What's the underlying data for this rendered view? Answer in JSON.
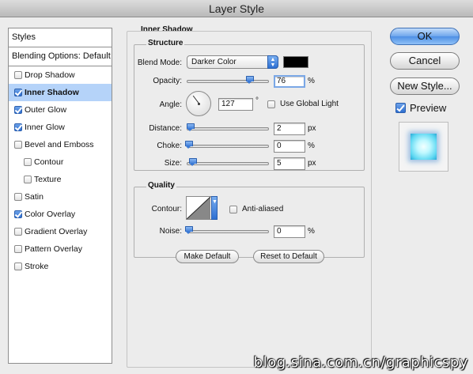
{
  "window": {
    "title": "Layer Style"
  },
  "styles_list": {
    "header": "Styles",
    "blending_options": "Blending Options: Default",
    "items": [
      {
        "label": "Drop Shadow",
        "checked": false,
        "sub": false,
        "selected": false
      },
      {
        "label": "Inner Shadow",
        "checked": true,
        "sub": false,
        "selected": true
      },
      {
        "label": "Outer Glow",
        "checked": true,
        "sub": false,
        "selected": false
      },
      {
        "label": "Inner Glow",
        "checked": true,
        "sub": false,
        "selected": false
      },
      {
        "label": "Bevel and Emboss",
        "checked": false,
        "sub": false,
        "selected": false
      },
      {
        "label": "Contour",
        "checked": false,
        "sub": true,
        "selected": false
      },
      {
        "label": "Texture",
        "checked": false,
        "sub": true,
        "selected": false
      },
      {
        "label": "Satin",
        "checked": false,
        "sub": false,
        "selected": false
      },
      {
        "label": "Color Overlay",
        "checked": true,
        "sub": false,
        "selected": false
      },
      {
        "label": "Gradient Overlay",
        "checked": false,
        "sub": false,
        "selected": false
      },
      {
        "label": "Pattern Overlay",
        "checked": false,
        "sub": false,
        "selected": false
      },
      {
        "label": "Stroke",
        "checked": false,
        "sub": false,
        "selected": false
      }
    ]
  },
  "inner_shadow": {
    "section_title": "Inner Shadow",
    "structure": {
      "title": "Structure",
      "blend_mode_label": "Blend Mode:",
      "blend_mode_value": "Darker Color",
      "blend_color": "#000000",
      "opacity_label": "Opacity:",
      "opacity_value": "76",
      "opacity_unit": "%",
      "angle_label": "Angle:",
      "angle_value": "127",
      "angle_unit": "°",
      "use_global_light_label": "Use Global Light",
      "use_global_light": false,
      "distance_label": "Distance:",
      "distance_value": "2",
      "distance_unit": "px",
      "choke_label": "Choke:",
      "choke_value": "0",
      "choke_unit": "%",
      "size_label": "Size:",
      "size_value": "5",
      "size_unit": "px"
    },
    "quality": {
      "title": "Quality",
      "contour_label": "Contour:",
      "anti_aliased_label": "Anti-aliased",
      "anti_aliased": false,
      "noise_label": "Noise:",
      "noise_value": "0",
      "noise_unit": "%"
    },
    "make_default_label": "Make Default",
    "reset_default_label": "Reset to Default"
  },
  "actions": {
    "ok_label": "OK",
    "cancel_label": "Cancel",
    "new_style_label": "New Style...",
    "preview_label": "Preview",
    "preview_checked": true
  },
  "watermark": "blog.sina.com.cn/graphicspy"
}
